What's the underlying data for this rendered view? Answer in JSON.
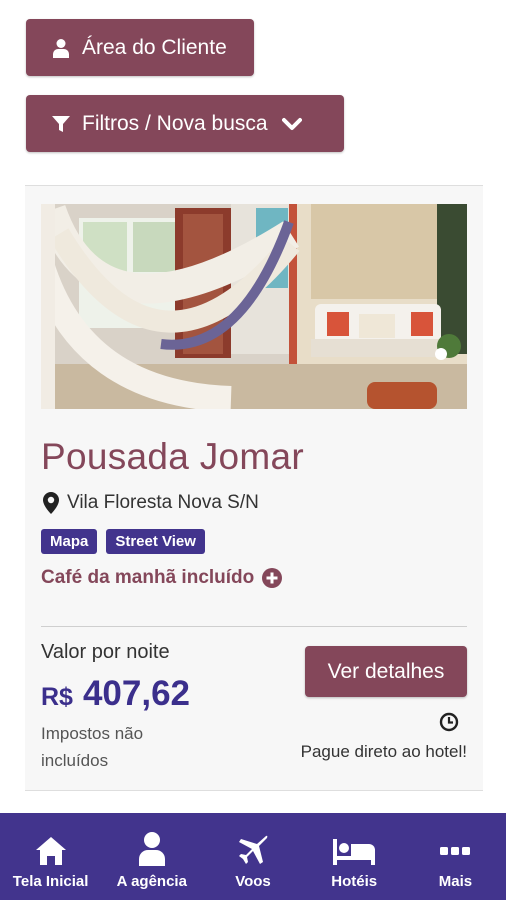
{
  "top_buttons": {
    "area_cliente": "Área do Cliente",
    "filtros": "Filtros / Nova busca"
  },
  "hotel": {
    "name": "Pousada Jomar",
    "address": "Vila Floresta Nova S/N",
    "tags": [
      "Mapa",
      "Street View"
    ],
    "breakfast": "Café da manhã incluído",
    "price_label": "Valor por noite",
    "currency": "R$",
    "price": "407,62",
    "taxes_note": "Impostos não incluídos",
    "details_button": "Ver detalhes",
    "payment_note": "Pague direto ao hotel!"
  },
  "bottom_nav": [
    {
      "label": "Tela Inicial",
      "icon": "home-icon"
    },
    {
      "label": "A agência",
      "icon": "user-icon"
    },
    {
      "label": "Voos",
      "icon": "plane-icon"
    },
    {
      "label": "Hotéis",
      "icon": "bed-icon"
    },
    {
      "label": "Mais",
      "icon": "more-icon"
    }
  ],
  "colors": {
    "accent": "#84475a",
    "nav": "#42348d",
    "price": "#3b2f8c"
  }
}
